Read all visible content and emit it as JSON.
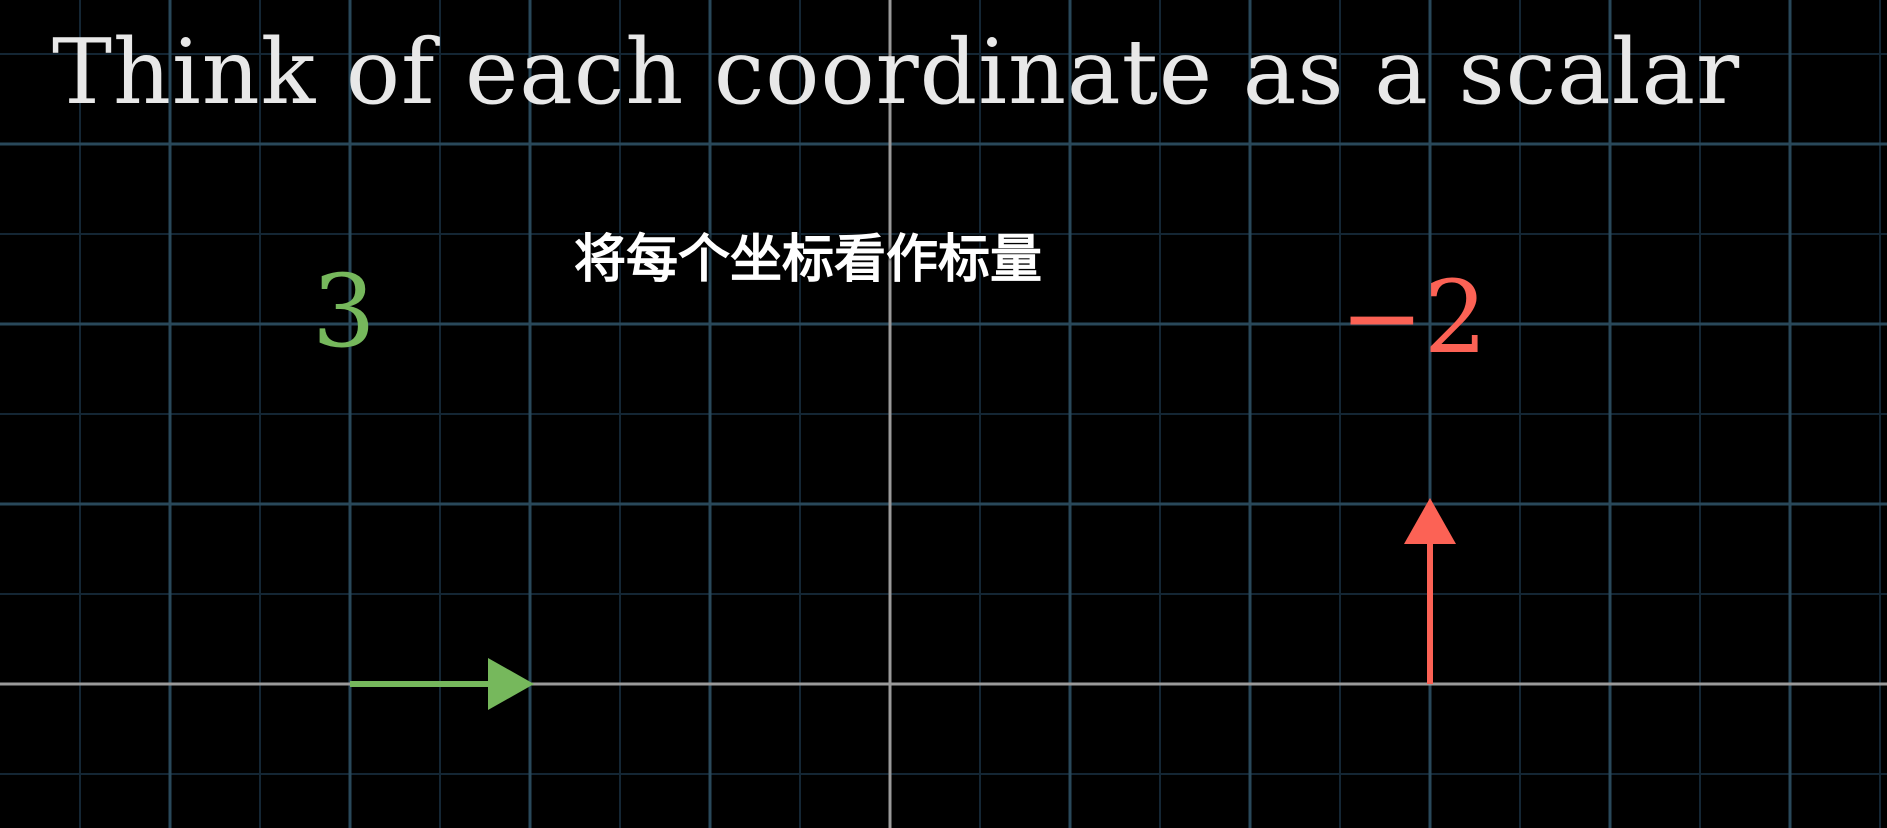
{
  "title": "Think of each coordinate as a scalar",
  "subtitle": "将每个坐标看作标量",
  "scalars": {
    "x": {
      "text": "3",
      "color": "#76b85c"
    },
    "y": {
      "text": "−2",
      "color": "#fc6255"
    }
  },
  "colors": {
    "background": "#000000",
    "major_grid": "#29485a",
    "minor_grid": "#142634",
    "axis": "#9a9a9a",
    "x_vector": "#76b85c",
    "y_vector": "#fc6255",
    "title": "#e8e8e8"
  }
}
